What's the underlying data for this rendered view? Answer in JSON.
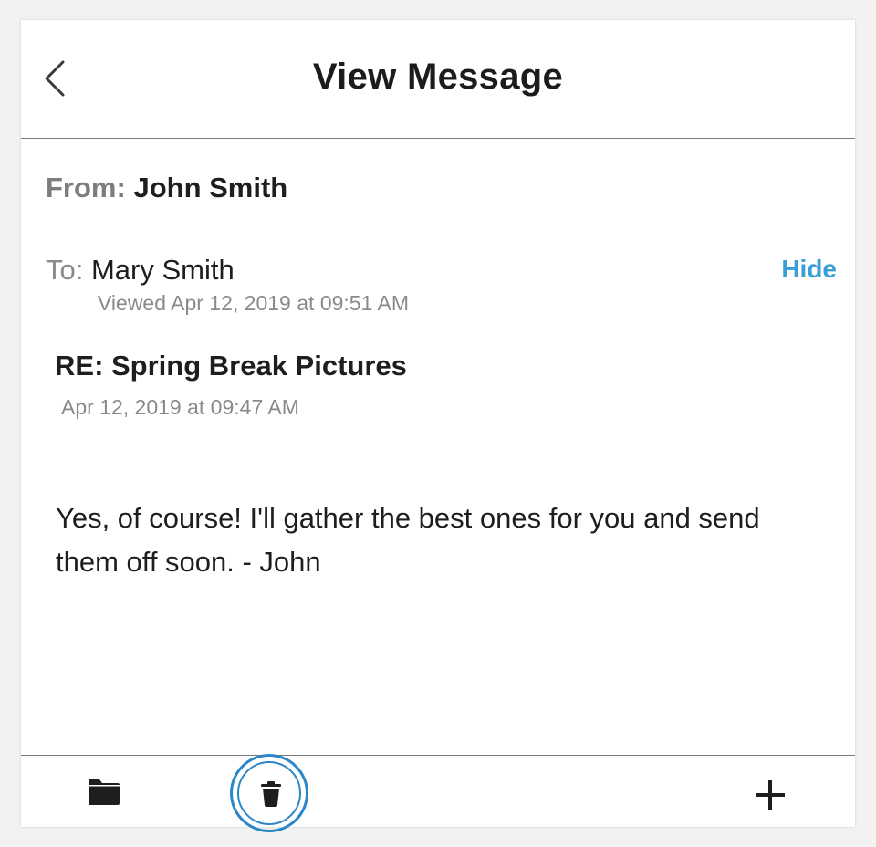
{
  "header": {
    "title": "View Message",
    "back_icon": "chevron-left-icon"
  },
  "message": {
    "from_label": "From:",
    "from_name": "John Smith",
    "to_label": "To:",
    "to_name": "Mary Smith",
    "viewed_text": "Viewed Apr 12, 2019 at 09:51 AM",
    "hide_label": "Hide",
    "subject": "RE: Spring Break Pictures",
    "sent_date": "Apr 12, 2019 at 09:47 AM",
    "body": "Yes, of course! I'll gather the best ones for you and send them off soon. - John"
  },
  "toolbar": {
    "folder_icon": "folder-icon",
    "trash_icon": "trash-icon",
    "plus_icon": "plus-icon"
  },
  "colors": {
    "accent": "#3a9fd6",
    "focus_ring": "#2b87c6",
    "text": "#1e1e1e",
    "muted": "#8a8a8a"
  }
}
